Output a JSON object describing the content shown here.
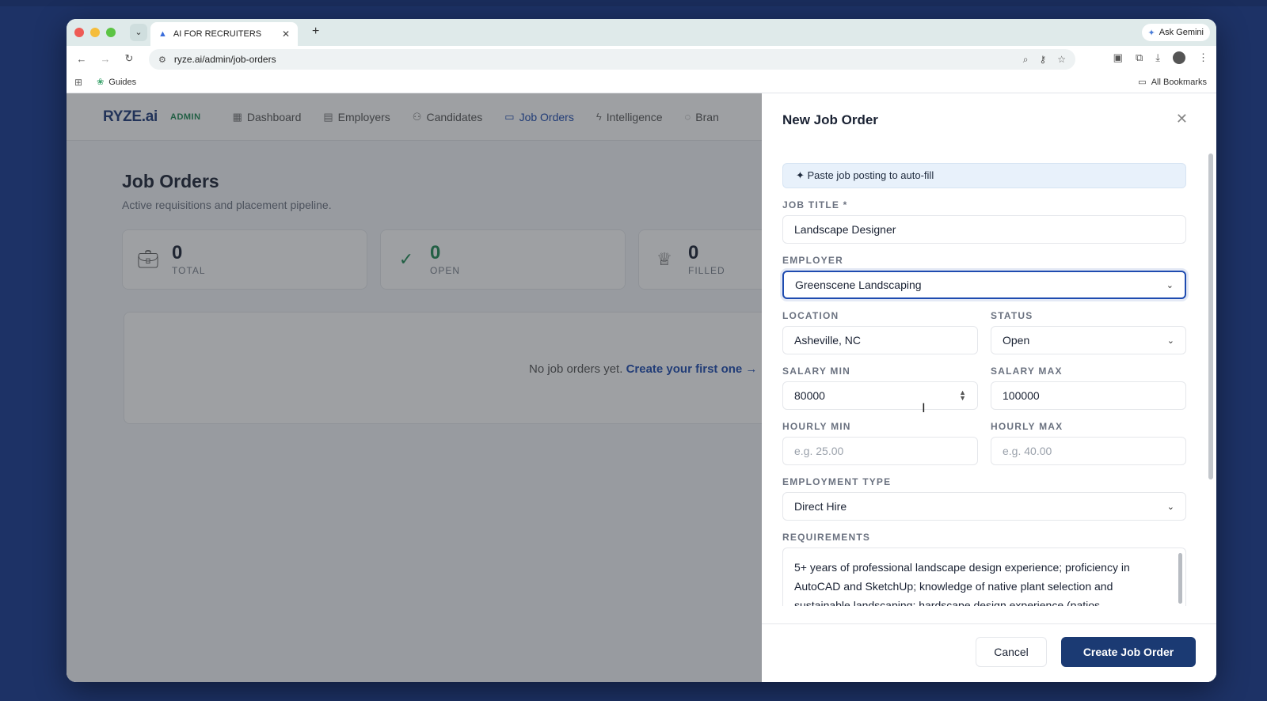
{
  "browser": {
    "tab_title": "AI FOR RECRUITERS",
    "new_tab": "+",
    "ask_gemini": "Ask Gemini",
    "url": "ryze.ai/admin/job-orders",
    "bookmark_guides": "Guides",
    "all_bookmarks": "All Bookmarks"
  },
  "app": {
    "logo": "RYZE.ai",
    "badge": "ADMIN",
    "nav": [
      {
        "label": "Dashboard",
        "icon": "dashboard-icon"
      },
      {
        "label": "Employers",
        "icon": "building-icon"
      },
      {
        "label": "Candidates",
        "icon": "users-icon"
      },
      {
        "label": "Job Orders",
        "icon": "briefcase-icon",
        "active": true
      },
      {
        "label": "Intelligence",
        "icon": "bolt-icon"
      },
      {
        "label": "Bran",
        "icon": "palette-icon"
      }
    ],
    "page_title": "Job Orders",
    "page_subtitle": "Active requisitions and placement pipeline.",
    "stats": [
      {
        "value": "0",
        "label": "TOTAL",
        "icon": "briefcase-icon"
      },
      {
        "value": "0",
        "label": "OPEN",
        "icon": "check-circle-icon"
      },
      {
        "value": "0",
        "label": "FILLED",
        "icon": "trophy-icon"
      }
    ],
    "empty_text": "No job orders yet.",
    "empty_link": "Create your first one →"
  },
  "modal": {
    "title": "New Job Order",
    "autofill_label": "✦ Paste job posting to auto-fill",
    "job_title_label": "JOB TITLE *",
    "job_title_value": "Landscape Designer",
    "employer_label": "EMPLOYER",
    "employer_value": "Greenscene Landscaping",
    "location_label": "LOCATION",
    "location_value": "Asheville, NC",
    "status_label": "STATUS",
    "status_value": "Open",
    "salary_min_label": "SALARY MIN",
    "salary_min_value": "80000",
    "salary_max_label": "SALARY MAX",
    "salary_max_value": "100000",
    "hourly_min_label": "HOURLY MIN",
    "hourly_min_placeholder": "e.g. 25.00",
    "hourly_max_label": "HOURLY MAX",
    "hourly_max_placeholder": "e.g. 40.00",
    "employment_type_label": "EMPLOYMENT TYPE",
    "employment_type_value": "Direct Hire",
    "requirements_label": "REQUIREMENTS",
    "requirements_lines": [
      "5+ years of professional landscape design experience; proficiency in",
      "AutoCAD and SketchUp; knowledge of native plant selection and",
      "sustainable landscaping; hardscape design experience (patios,"
    ],
    "cancel_label": "Cancel",
    "create_label": "Create Job Order"
  }
}
